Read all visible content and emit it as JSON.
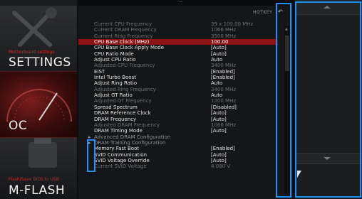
{
  "sidebar": {
    "settings": {
      "subtitle": "Motherboard settings",
      "title": "SETTINGS"
    },
    "oc": {
      "title": "OC"
    },
    "mflash": {
      "subtitle": "Flash/Save BIOS to USB",
      "title": "M-FLASH"
    }
  },
  "header": {
    "hotkey_label": "HOTKEY",
    "back_icon": "undo-arrow-icon"
  },
  "rows": [
    {
      "label": "Current CPU Frequency",
      "value": "39 x 100.00 MHz",
      "style": "dim"
    },
    {
      "label": "Current DRAM Frequency",
      "value": "1066 MHz",
      "style": "dim"
    },
    {
      "label": "Current Ring Frequency",
      "value": "3500 MHz",
      "style": "dim"
    },
    {
      "label": "CPU Base Clock (MHz)",
      "value": "100.00",
      "style": "hl"
    },
    {
      "label": "CPU Base Clock Apply Mode",
      "value": "[Auto]",
      "style": "normal"
    },
    {
      "label": "CPU Ratio Mode",
      "value": "[Auto]",
      "style": "normal"
    },
    {
      "label": "Adjust CPU Ratio",
      "value": "Auto",
      "style": "normal"
    },
    {
      "label": "Adjusted CPU Frequency",
      "value": "3400 MHz",
      "style": "dim"
    },
    {
      "label": "EIST",
      "value": "[Enabled]",
      "style": "normal"
    },
    {
      "label": "Intel Turbo Boost",
      "value": "[Enabled]",
      "style": "normal"
    },
    {
      "label": "Adjust Ring Ratio",
      "value": "Auto",
      "style": "normal"
    },
    {
      "label": "Adjusted Ring Frequency",
      "value": "3400 MHz",
      "style": "dim"
    },
    {
      "label": "Adjust GT Ratio",
      "value": "Auto",
      "style": "normal"
    },
    {
      "label": "Adjusted GT Frequency",
      "value": "1200 MHz",
      "style": "dim"
    },
    {
      "label": "Spread Spectrum",
      "value": "[Disabled]",
      "style": "normal"
    },
    {
      "label": "DRAM Reference Clock",
      "value": "[Auto]",
      "style": "normal"
    },
    {
      "label": "DRAM Frequency",
      "value": "[Auto]",
      "style": "normal"
    },
    {
      "label": "Adjusted DRAM Frequency",
      "value": "1066 MHz",
      "style": "dim"
    },
    {
      "label": "DRAM Timing Mode",
      "value": "[Auto]",
      "style": "normal"
    },
    {
      "label": "Advanced DRAM Configuration",
      "value": "",
      "style": "sub"
    },
    {
      "label": "DRAM Training Configuration",
      "value": "",
      "style": "sub"
    },
    {
      "label": "Memory Fast Boot",
      "value": "[Enabled]",
      "style": "normal"
    },
    {
      "label": "SVID Communication",
      "value": "[Auto]",
      "style": "normal"
    },
    {
      "label": "SVID Voltage Override",
      "value": "[Auto]",
      "style": "normal"
    },
    {
      "label": "Current SVID Voltage",
      "value": "4.080 V",
      "style": "dim"
    }
  ],
  "submenu_arrow": "▸"
}
